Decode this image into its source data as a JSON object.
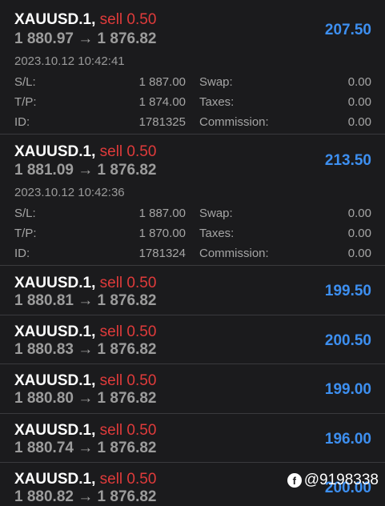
{
  "positions": [
    {
      "symbol": "XAUUSD.1,",
      "side": "sell 0.50",
      "price_open": "1 880.97",
      "arrow": "→",
      "price_current": "1 876.82",
      "profit": "207.50",
      "expanded": true,
      "time": "2023.10.12 10:42:41",
      "sl_label": "S/L:",
      "sl": "1 887.00",
      "tp_label": "T/P:",
      "tp": "1 874.00",
      "id_label": "ID:",
      "id": "1781325",
      "swap_label": "Swap:",
      "swap": "0.00",
      "taxes_label": "Taxes:",
      "taxes": "0.00",
      "commission_label": "Commission:",
      "commission": "0.00"
    },
    {
      "symbol": "XAUUSD.1,",
      "side": "sell 0.50",
      "price_open": "1 881.09",
      "arrow": "→",
      "price_current": "1 876.82",
      "profit": "213.50",
      "expanded": true,
      "time": "2023.10.12 10:42:36",
      "sl_label": "S/L:",
      "sl": "1 887.00",
      "tp_label": "T/P:",
      "tp": "1 870.00",
      "id_label": "ID:",
      "id": "1781324",
      "swap_label": "Swap:",
      "swap": "0.00",
      "taxes_label": "Taxes:",
      "taxes": "0.00",
      "commission_label": "Commission:",
      "commission": "0.00"
    },
    {
      "symbol": "XAUUSD.1,",
      "side": "sell 0.50",
      "price_open": "1 880.81",
      "arrow": "→",
      "price_current": "1 876.82",
      "profit": "199.50"
    },
    {
      "symbol": "XAUUSD.1,",
      "side": "sell 0.50",
      "price_open": "1 880.83",
      "arrow": "→",
      "price_current": "1 876.82",
      "profit": "200.50"
    },
    {
      "symbol": "XAUUSD.1,",
      "side": "sell 0.50",
      "price_open": "1 880.80",
      "arrow": "→",
      "price_current": "1 876.82",
      "profit": "199.00"
    },
    {
      "symbol": "XAUUSD.1,",
      "side": "sell 0.50",
      "price_open": "1 880.74",
      "arrow": "→",
      "price_current": "1 876.82",
      "profit": "196.00"
    },
    {
      "symbol": "XAUUSD.1,",
      "side": "sell 0.50",
      "price_open": "1 880.82",
      "arrow": "→",
      "price_current": "1 876.82",
      "profit": "200.00"
    }
  ],
  "watermark": {
    "icon": "facebook-icon",
    "icon_glyph": "f",
    "text": "@9198338"
  },
  "colors": {
    "background": "#1b1b1d",
    "sell": "#e03b3b",
    "profit": "#3d8ff0",
    "symbol": "#ffffff",
    "divider": "#3a3a3d"
  }
}
